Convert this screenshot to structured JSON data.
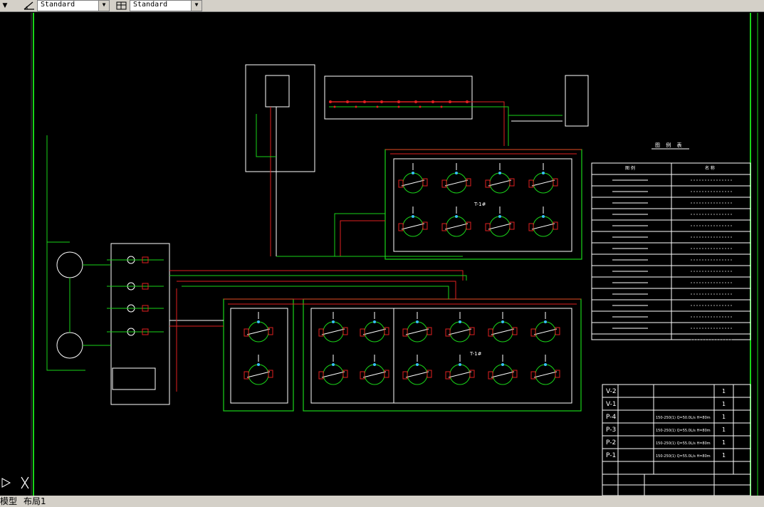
{
  "toolbar": {
    "style1": "Standard",
    "style2": "Standard"
  },
  "tabs": {
    "model": "模型",
    "layout": "布局1"
  },
  "drawing": {
    "main_unit_label": "T-1#",
    "legend_title": "图 例 表",
    "legend_head_symbol": "图 例",
    "legend_head_name": "名 称",
    "equipment": [
      {
        "code": "V-2",
        "qty": "1"
      },
      {
        "code": "V-1",
        "qty": "1"
      },
      {
        "code": "P-4",
        "spec": "150-250(1) Q=50.0L/s H=80m",
        "qty": "1"
      },
      {
        "code": "P-3",
        "spec": "150-250(1) Q=55.0L/s H=80m",
        "qty": "1"
      },
      {
        "code": "P-2",
        "spec": "150-250(1) Q=55.0L/s H=80m",
        "qty": "1"
      },
      {
        "code": "P-1",
        "spec": "150-250(1) Q=55.0L/s H=80m",
        "qty": "1"
      }
    ]
  }
}
